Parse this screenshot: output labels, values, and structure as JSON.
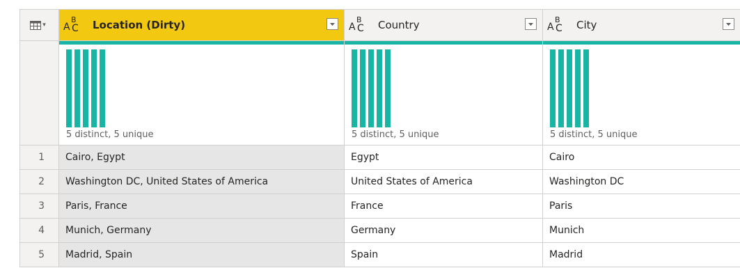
{
  "columns": [
    {
      "name": "Location (Dirty)",
      "type_icon": "text-type-icon",
      "profile": "5 distinct, 5 unique",
      "selected": true
    },
    {
      "name": "Country",
      "type_icon": "text-type-icon",
      "profile": "5 distinct, 5 unique",
      "selected": false
    },
    {
      "name": "City",
      "type_icon": "text-type-icon",
      "profile": "5 distinct, 5 unique",
      "selected": false
    }
  ],
  "type_glyph": {
    "a": "A",
    "b": "B",
    "c": "C"
  },
  "rows": [
    {
      "index": "1",
      "location": "Cairo, Egypt",
      "country": "Egypt",
      "city": "Cairo"
    },
    {
      "index": "2",
      "location": "Washington DC, United States of America",
      "country": "United States of America",
      "city": "Washington DC"
    },
    {
      "index": "3",
      "location": "Paris, France",
      "country": "France",
      "city": "Paris"
    },
    {
      "index": "4",
      "location": "Munich, Germany",
      "country": "Germany",
      "city": "Munich"
    },
    {
      "index": "5",
      "location": "Madrid, Spain",
      "country": "Spain",
      "city": "Madrid"
    }
  ],
  "colors": {
    "selected_header": "#f2c811",
    "quality_bar": "#18b5a4",
    "selected_column_bg": "#e6e6e6"
  }
}
